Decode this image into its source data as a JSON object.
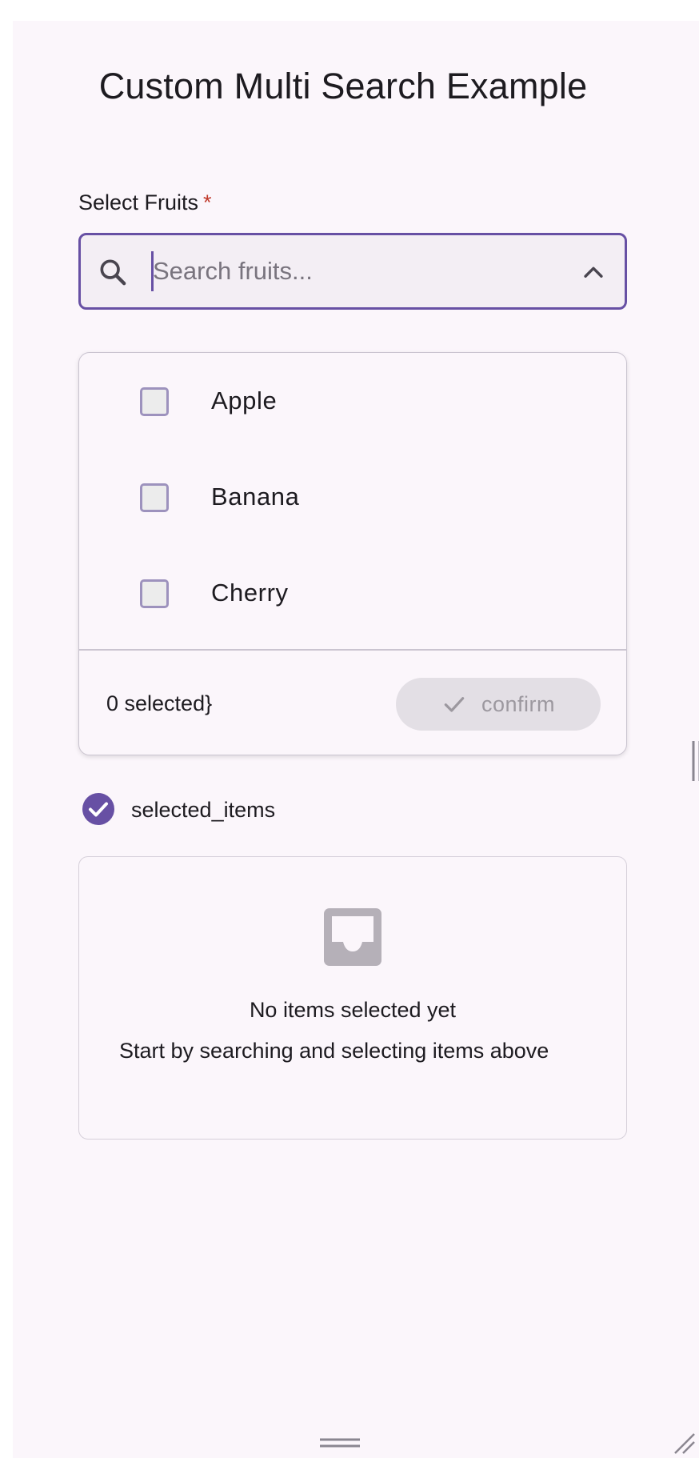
{
  "app": {
    "title": "Custom Multi Search Example"
  },
  "field": {
    "label": "Select Fruits",
    "required_marker": "*",
    "search_placeholder": "Search fruits...",
    "search_value": "",
    "leading_icon": "search-icon",
    "trailing_icon": "chevron-up-icon"
  },
  "dropdown": {
    "options": [
      {
        "label": "Apple",
        "checked": false
      },
      {
        "label": "Banana",
        "checked": false
      },
      {
        "label": "Cherry",
        "checked": false
      }
    ],
    "selected_count_text": "0 selected}",
    "confirm_label": "confirm",
    "confirm_icon": "check-icon",
    "confirm_enabled": false
  },
  "selected_section": {
    "label": "selected_items",
    "icon": "check-circle-icon"
  },
  "empty_state": {
    "icon": "inbox-icon",
    "title": "No items selected yet",
    "subtitle": "Start by searching and selecting items above"
  },
  "colors": {
    "primary": "#6750a4",
    "background": "#fbf6fb",
    "required": "#c0392b",
    "disabled_button": "#e3dfe5"
  }
}
